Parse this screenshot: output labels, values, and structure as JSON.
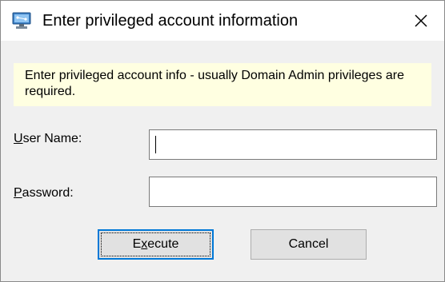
{
  "window": {
    "title": "Enter privileged account information",
    "icon": "computer-network-icon",
    "close_glyph": "✕"
  },
  "info": {
    "text": "Enter privileged account info - usually Domain Admin privileges are required."
  },
  "form": {
    "user_label_accel": "U",
    "user_label_rest": "ser Name:",
    "user_value": "",
    "password_label_accel": "P",
    "password_label_rest": "assword:",
    "password_value": ""
  },
  "buttons": {
    "execute_pre": "E",
    "execute_accel": "x",
    "execute_post": "ecute",
    "cancel_label": "Cancel"
  },
  "colors": {
    "info_background": "#ffffe1",
    "dialog_background": "#f0f0f0",
    "default_button_border": "#0078d7"
  }
}
